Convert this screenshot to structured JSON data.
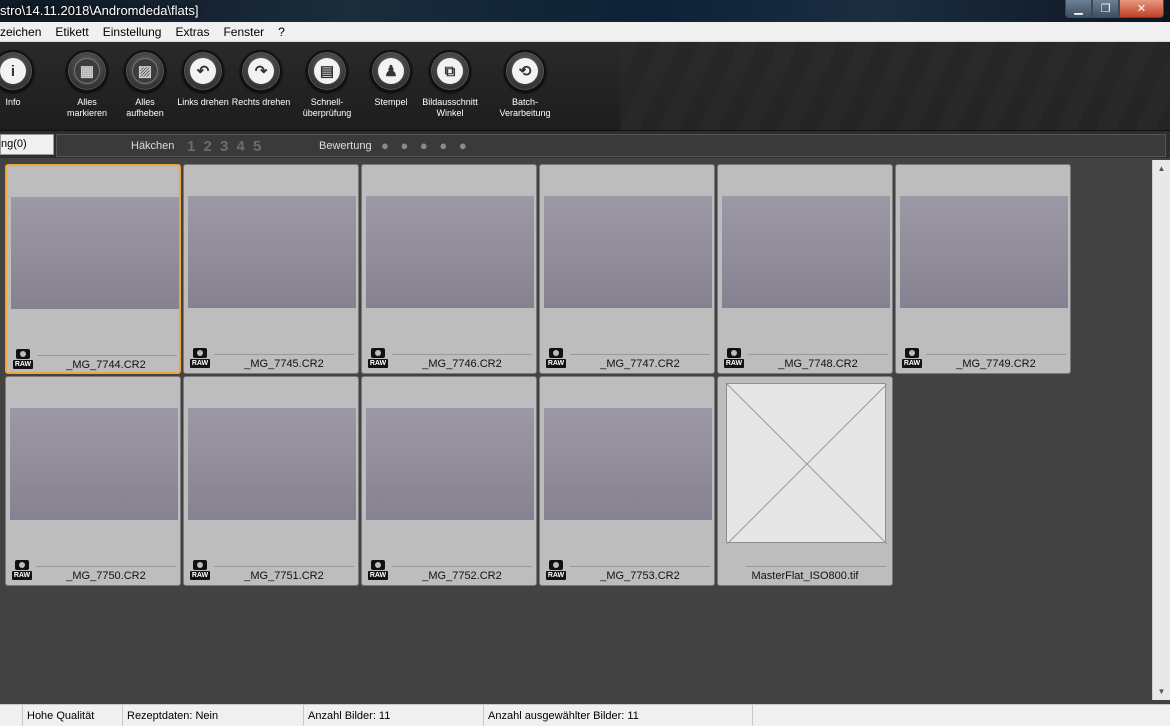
{
  "window": {
    "title": "stro\\14.11.2018\\Andromdeda\\flats]",
    "minimize": "▁",
    "maximize": "❐",
    "close": "✕"
  },
  "menu": [
    "zeichen",
    "Etikett",
    "Einstellung",
    "Extras",
    "Fenster",
    "?"
  ],
  "toolbar": [
    {
      "label": "Info",
      "icon": "info-icon",
      "glyph": "i"
    },
    {
      "label": "Alles\nmarkieren",
      "icon": "select-all-icon",
      "glyph": "▦"
    },
    {
      "label": "Alles\naufheben",
      "icon": "deselect-all-icon",
      "glyph": "▨"
    },
    {
      "label": "Links drehen",
      "icon": "rotate-left-icon",
      "glyph": "↶"
    },
    {
      "label": "Rechts drehen",
      "icon": "rotate-right-icon",
      "glyph": "↷"
    },
    {
      "label": "Schnell-\nüberprüfung",
      "icon": "quick-check-icon",
      "glyph": "▤"
    },
    {
      "label": "Stempel",
      "icon": "stamp-icon",
      "glyph": "♟"
    },
    {
      "label": "Bildausschnitt\nWinkel",
      "icon": "crop-angle-icon",
      "glyph": "⧉"
    },
    {
      "label": "Batch-\nVerarbeitung",
      "icon": "batch-process-icon",
      "glyph": "⟲"
    }
  ],
  "filter": {
    "tab_label": "ng(0)",
    "check_label": "Häkchen",
    "check_numbers": "1 2 3 4 5",
    "rating_label": "Bewertung",
    "rating_dots": "● ● ● ● ●"
  },
  "thumbnails": [
    {
      "name": "_MG_7744.CR2",
      "raw": "RAW",
      "selected": true
    },
    {
      "name": "_MG_7745.CR2",
      "raw": "RAW"
    },
    {
      "name": "_MG_7746.CR2",
      "raw": "RAW"
    },
    {
      "name": "_MG_7747.CR2",
      "raw": "RAW"
    },
    {
      "name": "_MG_7748.CR2",
      "raw": "RAW"
    },
    {
      "name": "_MG_7749.CR2",
      "raw": "RAW"
    },
    {
      "name": "_MG_7750.CR2",
      "raw": "RAW"
    },
    {
      "name": "_MG_7751.CR2",
      "raw": "RAW"
    },
    {
      "name": "_MG_7752.CR2",
      "raw": "RAW"
    },
    {
      "name": "_MG_7753.CR2",
      "raw": "RAW"
    },
    {
      "name": "MasterFlat_ISO800.tif",
      "placeholder": true
    }
  ],
  "status": {
    "quality": "Hohe Qualität",
    "recipe": "Rezeptdaten: Nein",
    "count": "Anzahl Bilder: 11",
    "selected_count": "Anzahl ausgewählter Bilder: 11"
  },
  "colors": {
    "selection": "#f0a632",
    "background": "#424242",
    "toolbar": "#1f1f1f"
  }
}
